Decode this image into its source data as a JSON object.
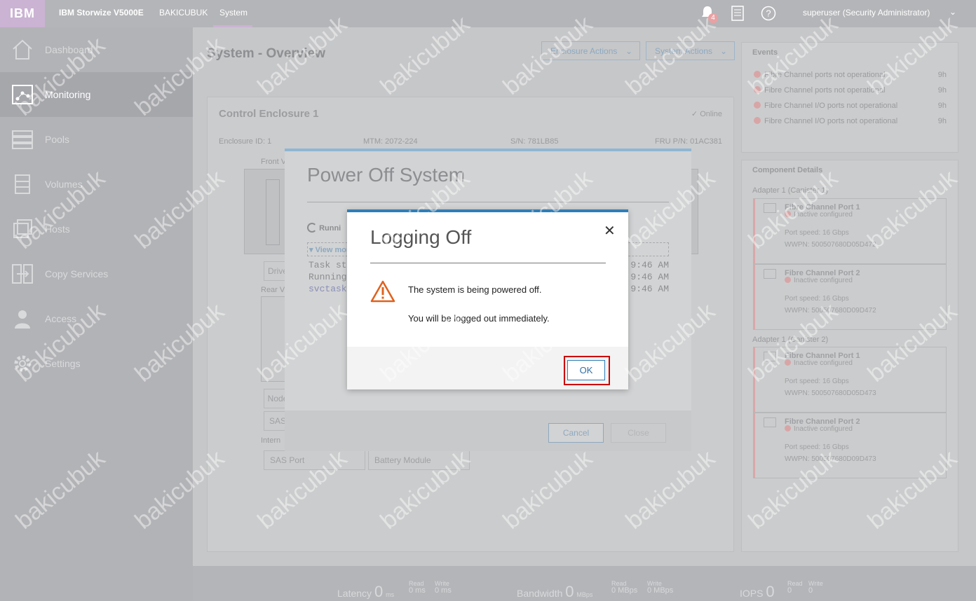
{
  "topbar": {
    "logo": "IBM",
    "product": "IBM Storwize V5000E",
    "system_name": "BAKICUBUK",
    "current_page": "System",
    "notification_count": "4",
    "user": "superuser (Security Administrator)"
  },
  "sidebar": {
    "items": [
      {
        "label": "Dashboard",
        "icon": "home-icon"
      },
      {
        "label": "Monitoring",
        "icon": "monitoring-icon"
      },
      {
        "label": "Pools",
        "icon": "pools-icon"
      },
      {
        "label": "Volumes",
        "icon": "volumes-icon"
      },
      {
        "label": "Hosts",
        "icon": "hosts-icon"
      },
      {
        "label": "Copy Services",
        "icon": "copy-services-icon"
      },
      {
        "label": "Access",
        "icon": "access-icon"
      },
      {
        "label": "Settings",
        "icon": "gear-icon"
      }
    ],
    "active": "Monitoring"
  },
  "main": {
    "title": "System - Overview",
    "enclosure_actions": "Enclosure Actions",
    "system_actions": "System Actions",
    "enclosure": {
      "name": "Control Enclosure 1",
      "status": "Online",
      "id": "Enclosure ID: 1",
      "mtm": "MTM: 2072-224",
      "sn": "S/N: 781LB85",
      "fru": "FRU P/N: 01AC381",
      "front_label": "Front V",
      "rear_label": "Rear V",
      "internal_label": "Intern",
      "drive_btn": "Drive",
      "node_btn": "Node",
      "sas_btn": "SAS",
      "sas_port": "SAS Port",
      "battery_module": "Battery Module"
    }
  },
  "events": {
    "title": "Events",
    "items": [
      {
        "text": "Fibre Channel ports not operational",
        "time": "9h"
      },
      {
        "text": "Fibre Channel ports not operational",
        "time": "9h"
      },
      {
        "text": "Fibre Channel I/O ports not operational",
        "time": "9h"
      },
      {
        "text": "Fibre Channel I/O ports not operational",
        "time": "9h"
      }
    ]
  },
  "components": {
    "title": "Component Details",
    "adapter1": "Adapter 1 (Canister 1)",
    "adapter2": "Adapter 1 (Canister 2)",
    "speed_label": "Port speed:",
    "wwpn_label": "WWPN:",
    "ports": [
      {
        "name": "Fibre Channel Port 1",
        "status": "Inactive configured",
        "speed": "16 Gbps",
        "wwpn": "500507680D05D472"
      },
      {
        "name": "Fibre Channel Port 2",
        "status": "Inactive configured",
        "speed": "16 Gbps",
        "wwpn": "500507680D09D472"
      },
      {
        "name": "Fibre Channel Port 1",
        "status": "Inactive configured",
        "speed": "16 Gbps",
        "wwpn": "500507680D05D473"
      },
      {
        "name": "Fibre Channel Port 2",
        "status": "Inactive configured",
        "speed": "16 Gbps",
        "wwpn": "500507680D09D473"
      }
    ]
  },
  "power_dialog": {
    "title": "Power Off System",
    "running": "Runni",
    "view_more": "View mor",
    "log": [
      "Task st",
      "Running",
      "svctask"
    ],
    "times": [
      "9:46 AM",
      "9:46 AM",
      "9:46 AM"
    ],
    "cancel": "Cancel",
    "close": "Close"
  },
  "modal": {
    "title": "Logging Off",
    "line1": "The system is being powered off.",
    "line2": "You will be logged out immediately.",
    "ok": "OK"
  },
  "bottom": {
    "latency_label": "Latency",
    "latency": "0",
    "latency_unit": "ms",
    "read_label": "Read",
    "write_label": "Write",
    "lat_read": "0 ms",
    "lat_write": "0 ms",
    "bandwidth_label": "Bandwidth",
    "bandwidth": "0",
    "bandwidth_unit": "MBps",
    "bw_read": "0 MBps",
    "bw_write": "0 MBps",
    "iops_label": "IOPS",
    "iops": "0",
    "iops_read": "0",
    "iops_write": "0"
  },
  "watermark": "bakicubuk"
}
